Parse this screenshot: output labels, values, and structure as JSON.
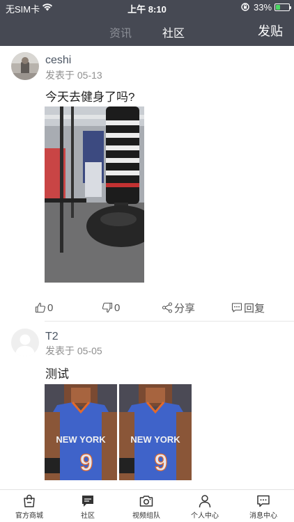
{
  "status_bar": {
    "carrier": "无SIM卡",
    "time": "上午 8:10",
    "battery_percent": "33%",
    "battery_level": 0.33
  },
  "nav": {
    "tabs": [
      {
        "label": "资讯",
        "active": false
      },
      {
        "label": "社区",
        "active": true
      }
    ],
    "post_button": "发贴"
  },
  "posts": [
    {
      "username": "ceshi",
      "date": "发表于 05-13",
      "content": "今天去健身了吗?",
      "likes": "0",
      "dislikes": "0",
      "share_label": "分享",
      "reply_label": "回复"
    },
    {
      "username": "T2",
      "date": "发表于 05-05",
      "content": "测试",
      "jersey_text": "NEW YORK"
    }
  ],
  "tabbar": {
    "items": [
      {
        "label": "官方商城",
        "icon": "shopping-bag-icon"
      },
      {
        "label": "社区",
        "icon": "chat-bubble-icon",
        "active": true
      },
      {
        "label": "视频组队",
        "icon": "camera-icon"
      },
      {
        "label": "个人中心",
        "icon": "person-icon"
      },
      {
        "label": "消息中心",
        "icon": "message-icon"
      }
    ]
  },
  "colors": {
    "header_bg": "#464953",
    "active_tab": "#ffffff",
    "inactive_tab": "#8c8f97",
    "battery_green": "#4cd964"
  }
}
